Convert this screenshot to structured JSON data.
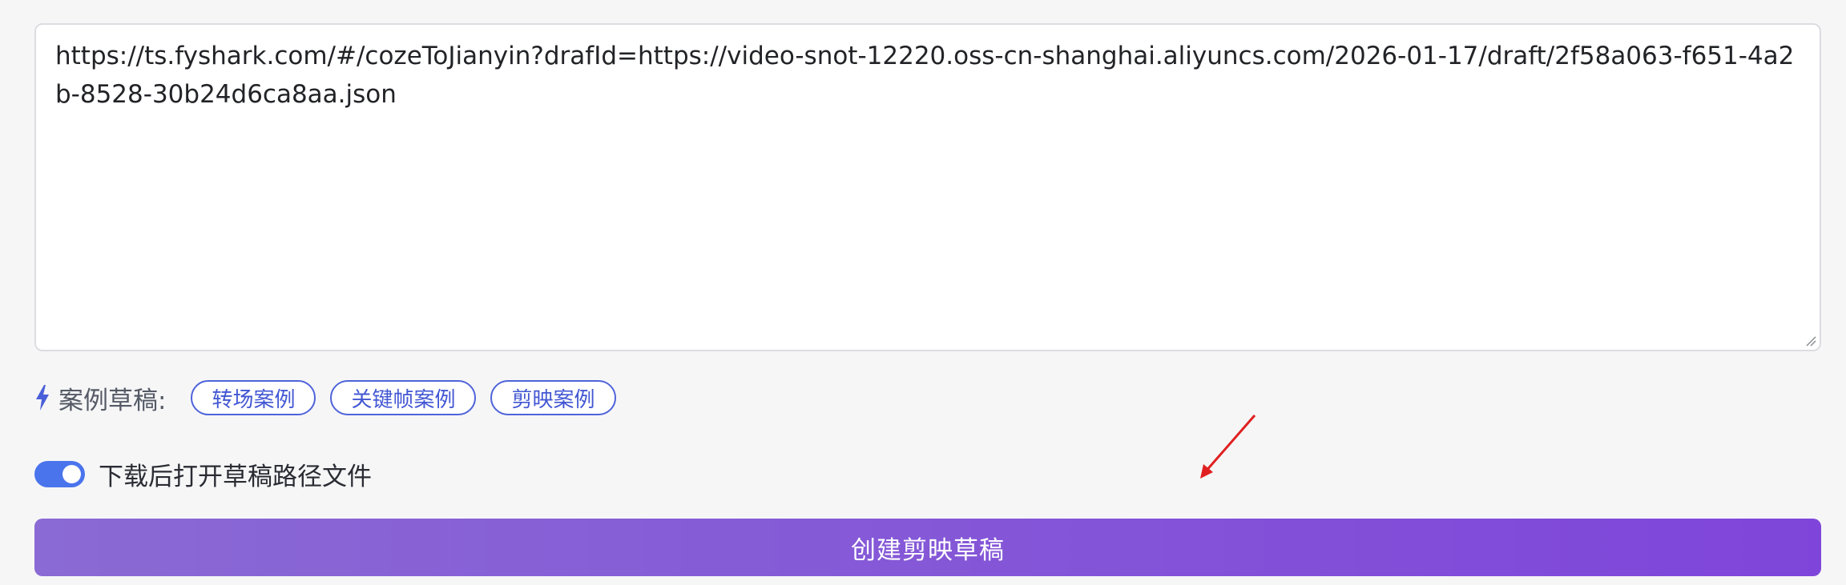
{
  "draft_url": {
    "value": "https://ts.fyshark.com/#/cozeToJianyin?drafId=https://video-snot-12220.oss-cn-shanghai.aliyuncs.com/2026-01-17/draft/2f58a063-f651-4a2b-8528-30b24d6ca8aa.json"
  },
  "examples": {
    "label": "案例草稿:",
    "icon": "bolt-icon",
    "items": [
      {
        "label": "转场案例"
      },
      {
        "label": "关键帧案例"
      },
      {
        "label": "剪映案例"
      }
    ]
  },
  "open_after_download": {
    "label": "下载后打开草稿路径文件",
    "enabled": true
  },
  "create_button": {
    "label": "创建剪映草稿"
  },
  "colors": {
    "accent": "#4a74ec",
    "chip_border": "#4f63d9",
    "button_gradient_start": "#8a6ad4",
    "button_gradient_end": "#7f45da",
    "annotation_arrow": "#e02020"
  }
}
